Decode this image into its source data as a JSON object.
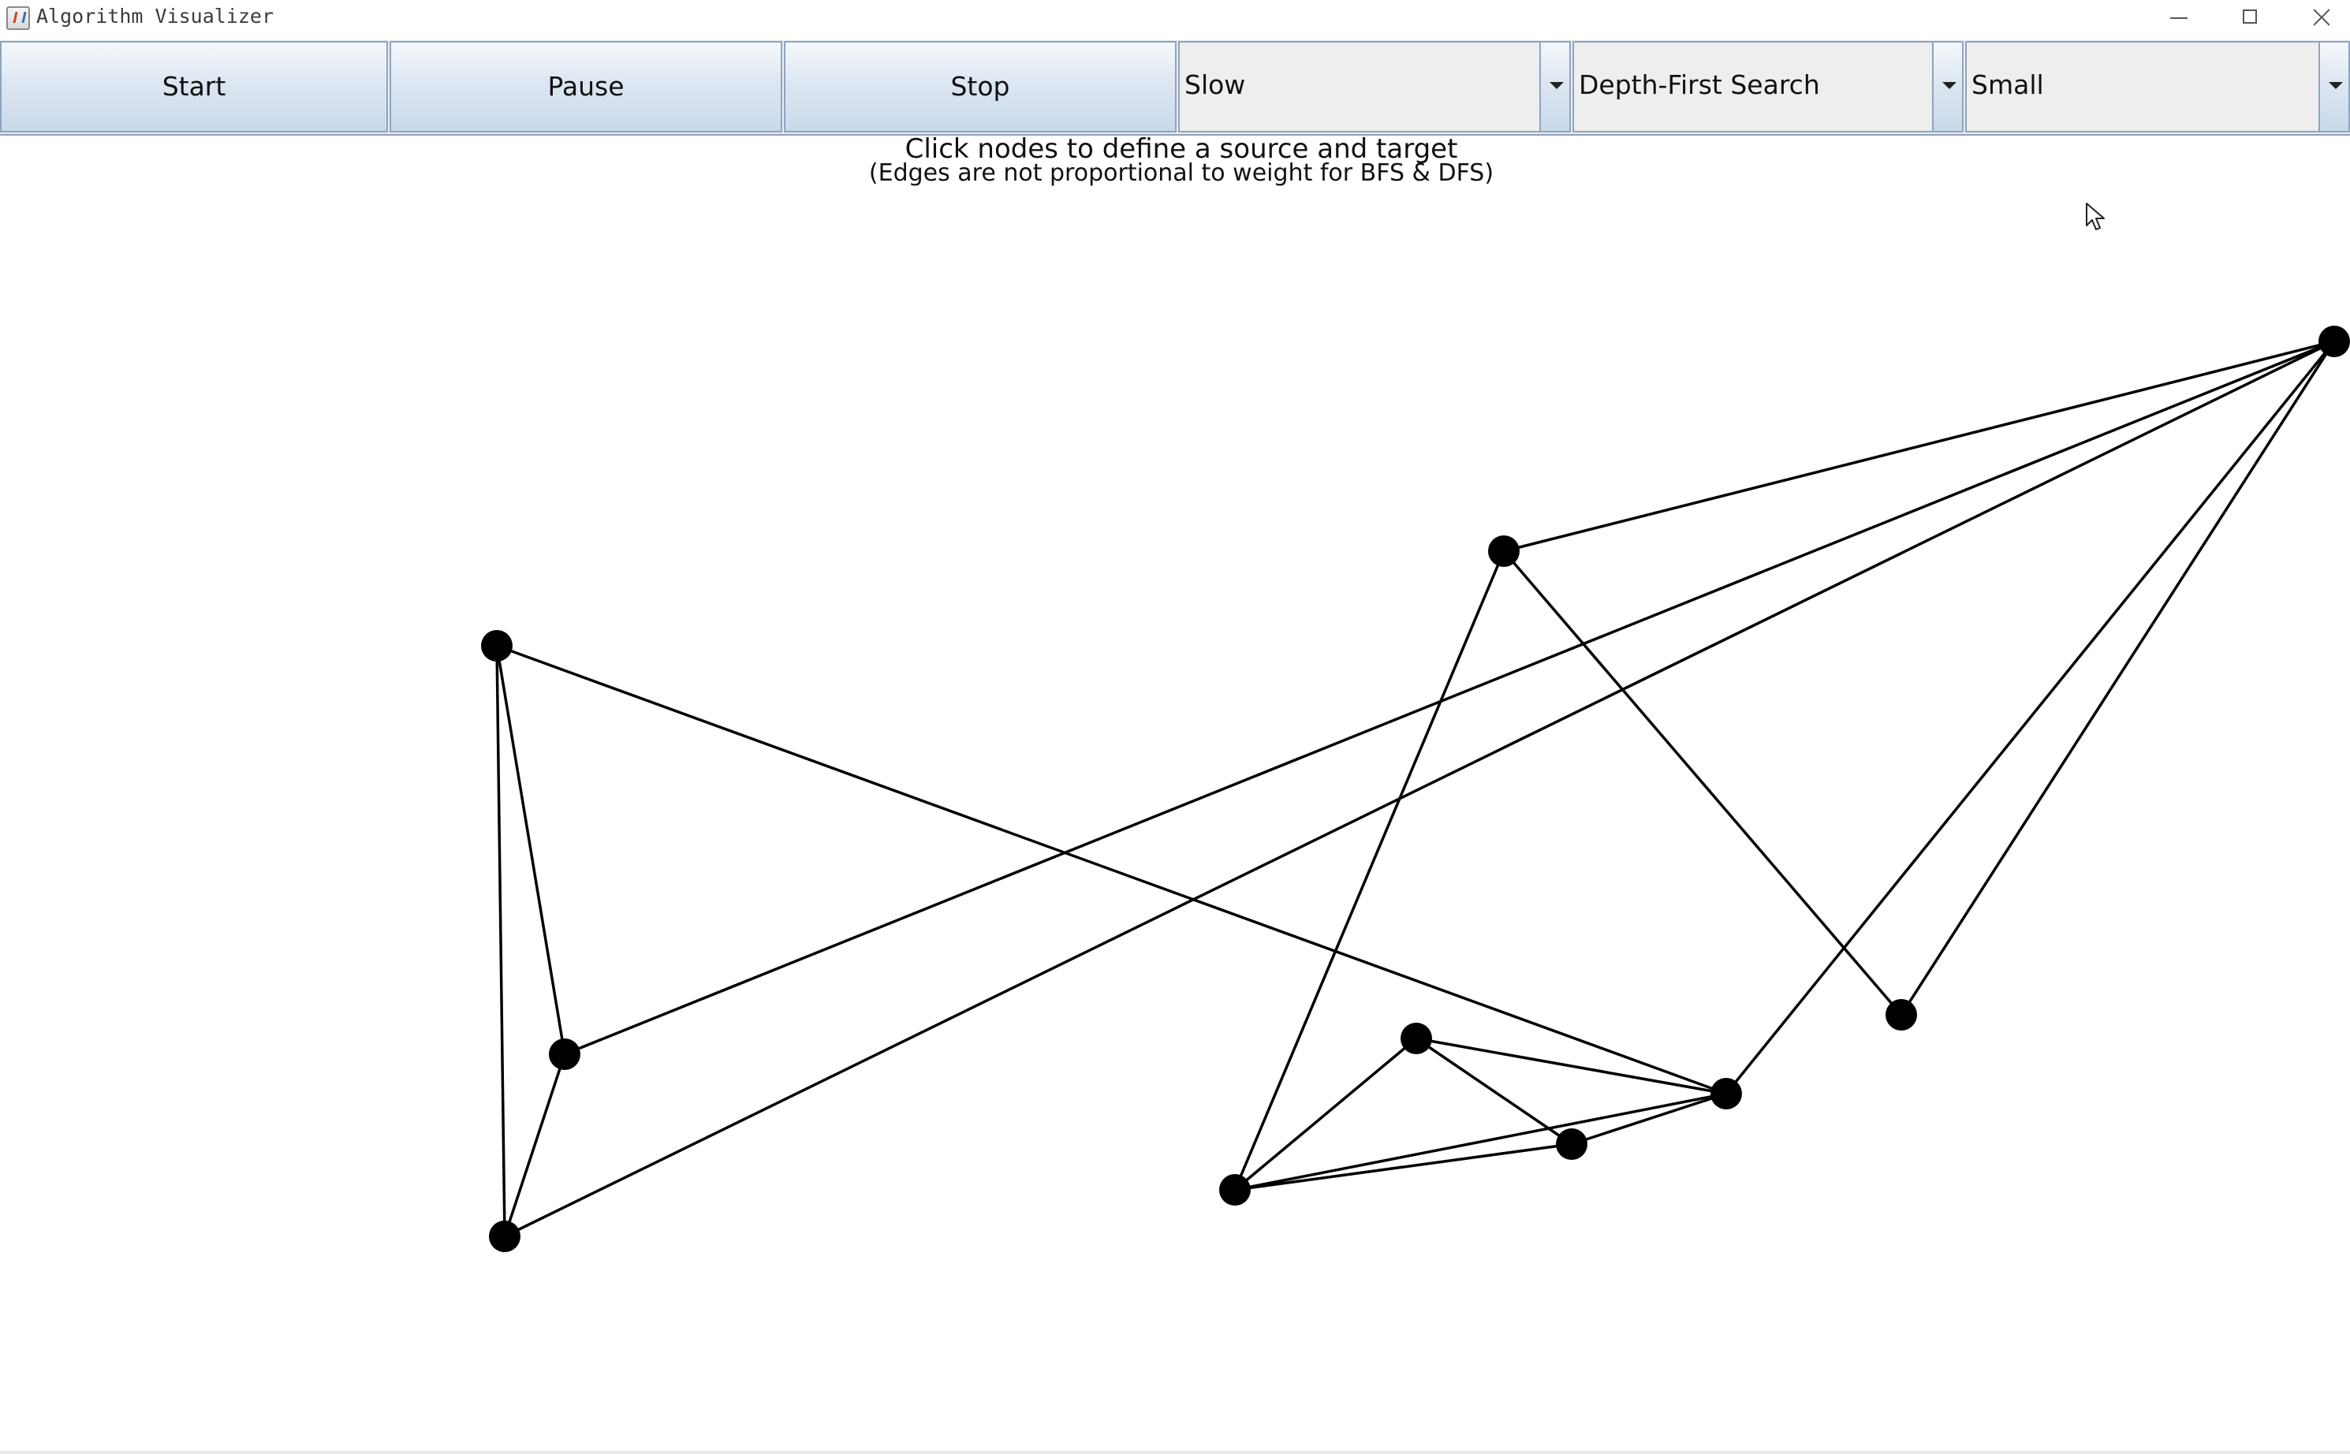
{
  "window": {
    "title": "Algorithm Visualizer",
    "controls": [
      "minimize",
      "maximize",
      "close"
    ]
  },
  "toolbar": {
    "start_label": "Start",
    "pause_label": "Pause",
    "stop_label": "Stop",
    "speed": {
      "selected": "Slow"
    },
    "algorithm": {
      "selected": "Depth-First Search"
    },
    "graph_size": {
      "selected": "Small"
    }
  },
  "instructions": {
    "main": "Click nodes to define a source and target",
    "sub": "(Edges are not proportional to weight for BFS & DFS)"
  },
  "graph": {
    "node_color": "#000000",
    "edge_color": "#000000",
    "nodes": [
      {
        "id": "n0"
      },
      {
        "id": "n1"
      },
      {
        "id": "n2"
      },
      {
        "id": "n3"
      },
      {
        "id": "n4"
      },
      {
        "id": "n5"
      },
      {
        "id": "n6"
      },
      {
        "id": "n7"
      },
      {
        "id": "n8"
      },
      {
        "id": "n9"
      }
    ],
    "edges": [
      [
        "n0",
        "n8"
      ],
      [
        "n0",
        "n9"
      ],
      [
        "n0",
        "n6"
      ],
      [
        "n0",
        "n3"
      ],
      [
        "n0",
        "n1"
      ],
      [
        "n1",
        "n7"
      ],
      [
        "n1",
        "n6"
      ],
      [
        "n2",
        "n3"
      ],
      [
        "n2",
        "n8"
      ],
      [
        "n2",
        "n9"
      ],
      [
        "n3",
        "n7"
      ],
      [
        "n3",
        "n5"
      ],
      [
        "n3",
        "n4"
      ],
      [
        "n4",
        "n5"
      ],
      [
        "n4",
        "n7"
      ],
      [
        "n5",
        "n7"
      ],
      [
        "n8",
        "n9"
      ]
    ]
  },
  "icons": {
    "app": "java-cup-icon",
    "cursor": "mouse-pointer-icon"
  }
}
